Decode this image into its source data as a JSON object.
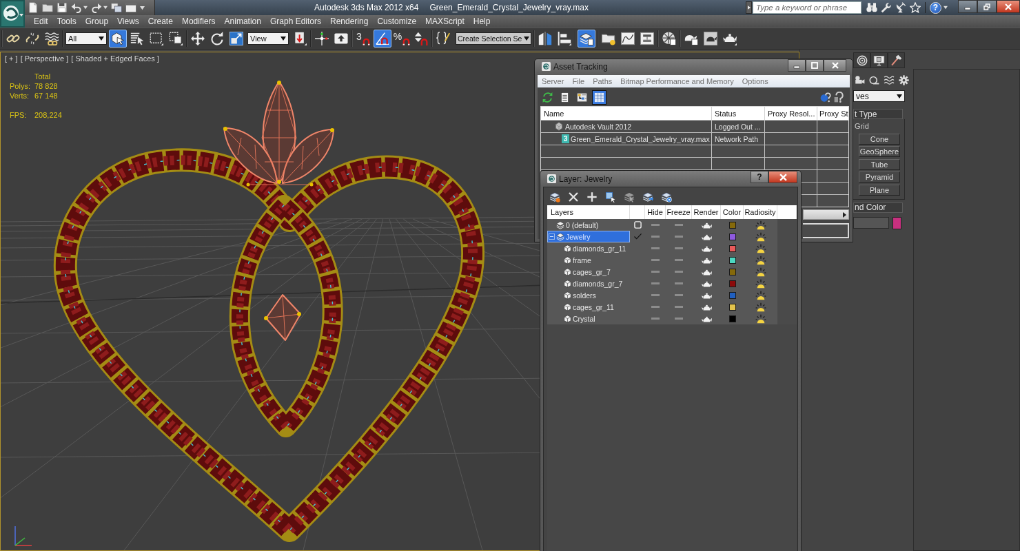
{
  "title_bar": {
    "app_title": "Autodesk 3ds Max 2012 x64",
    "file_name": "Green_Emerald_Crystal_Jewelry_vray.max",
    "search": {
      "placeholder": "Type a keyword or phrase"
    },
    "help": "?"
  },
  "menu_bar": [
    "Edit",
    "Tools",
    "Group",
    "Views",
    "Create",
    "Modifiers",
    "Animation",
    "Graph Editors",
    "Rendering",
    "Customize",
    "MAXScript",
    "Help"
  ],
  "toolbar": [
    {
      "kind": "button",
      "on": false
    },
    {
      "kind": "button",
      "on": false
    },
    {
      "kind": "button",
      "on": false
    },
    {
      "kind": "dropdown",
      "value": "All"
    },
    {
      "kind": "button",
      "on": true
    },
    {
      "kind": "button",
      "on": false
    },
    {
      "kind": "button",
      "on": false
    },
    {
      "kind": "button",
      "on": false
    },
    {
      "kind": "button",
      "on": false
    },
    {
      "kind": "button",
      "on": false
    },
    {
      "kind": "button",
      "on": false
    },
    {
      "kind": "dropdown",
      "value": "View"
    },
    {
      "kind": "button",
      "on": false
    },
    {
      "kind": "button",
      "on": false
    },
    {
      "kind": "button",
      "on": false
    },
    {
      "kind": "button",
      "on": false,
      "glyph": "3"
    },
    {
      "kind": "button",
      "on": true
    },
    {
      "kind": "button",
      "on": false,
      "glyph": "%"
    },
    {
      "kind": "button",
      "on": false
    },
    {
      "kind": "button",
      "on": false
    },
    {
      "kind": "field",
      "value": "Create Selection Se"
    },
    {
      "kind": "button",
      "on": false
    },
    {
      "kind": "button",
      "on": false
    },
    {
      "kind": "button",
      "on": true
    },
    {
      "kind": "button",
      "on": false
    },
    {
      "kind": "button",
      "on": false
    },
    {
      "kind": "button",
      "on": false
    },
    {
      "kind": "button",
      "on": false
    },
    {
      "kind": "button",
      "on": false
    },
    {
      "kind": "button",
      "on": false
    },
    {
      "kind": "button",
      "on": false
    }
  ],
  "viewport": {
    "labels": [
      "[ + ]",
      "[ Perspective ]",
      "[ Shaded + Edged Faces ]"
    ],
    "stats": {
      "heading": "Total",
      "rows": [
        {
          "label": "Polys:",
          "value": "78 828"
        },
        {
          "label": "Verts:",
          "value": "67 148"
        }
      ]
    },
    "fps": {
      "label": "FPS:",
      "value": "208,224"
    }
  },
  "asset_tracking": {
    "title": "Asset Tracking",
    "menu": [
      "Server",
      "File",
      "Paths",
      "Bitmap Performance and Memory",
      "Options"
    ],
    "toolbar": [
      {
        "selected": false
      },
      {
        "selected": false
      },
      {
        "selected": false
      },
      {
        "selected": true
      }
    ],
    "columns": [
      "Name",
      "Status",
      "Proxy Resol...",
      "Proxy St"
    ],
    "rows": [
      {
        "kind": "server",
        "name": "Autodesk Vault 2012",
        "status": "Logged Out ..."
      },
      {
        "kind": "file",
        "badge": "3",
        "name": "Green_Emerald_Crystal_Jewelry_vray.max",
        "status": "Network Path"
      }
    ]
  },
  "layer_window": {
    "title": "Layer: Jewelry",
    "help_button": "?",
    "columns": [
      "Layers",
      "Hide",
      "Freeze",
      "Render",
      "Color",
      "Radiosity"
    ],
    "layers": [
      {
        "name": "0 (default)",
        "selected": false,
        "current": false,
        "hidden": false,
        "frozen": false,
        "renderable": true,
        "radiosity": true,
        "color": "#85690a"
      },
      {
        "name": "Jewelry",
        "selected": true,
        "current": true,
        "expanded": true,
        "hidden": false,
        "frozen": false,
        "renderable": true,
        "radiosity": true,
        "color": "#8e5ae0",
        "children": [
          {
            "name": "diamonds_gr_11",
            "selected": false,
            "hidden": false,
            "frozen": false,
            "renderable": true,
            "radiosity": true,
            "color": "#e85a5a"
          },
          {
            "name": "frame",
            "selected": false,
            "hidden": false,
            "frozen": false,
            "renderable": true,
            "radiosity": true,
            "color": "#4cd8c2"
          },
          {
            "name": "cages_gr_7",
            "selected": false,
            "hidden": false,
            "frozen": false,
            "renderable": true,
            "radiosity": true,
            "color": "#85690a"
          },
          {
            "name": "diamonds_gr_7",
            "selected": false,
            "hidden": false,
            "frozen": false,
            "renderable": true,
            "radiosity": true,
            "color": "#8c0a0a"
          },
          {
            "name": "solders",
            "selected": false,
            "hidden": false,
            "frozen": false,
            "renderable": true,
            "radiosity": true,
            "color": "#1f5fc0"
          },
          {
            "name": "cages_gr_11",
            "selected": false,
            "hidden": false,
            "frozen": false,
            "renderable": true,
            "radiosity": true,
            "color": "#e2c24c"
          },
          {
            "name": "Crystal",
            "selected": false,
            "hidden": false,
            "frozen": false,
            "renderable": true,
            "radiosity": true,
            "color": "#000000"
          }
        ]
      }
    ]
  },
  "command_panel": {
    "dropdown": "ves",
    "rollouts": [
      {
        "title": "t Type",
        "option": "Grid",
        "buttons": [
          "Cone",
          "GeoSphere",
          "Tube",
          "Pyramid",
          "Plane"
        ]
      },
      {
        "title": "nd Color",
        "color": "#c8307f"
      }
    ]
  }
}
